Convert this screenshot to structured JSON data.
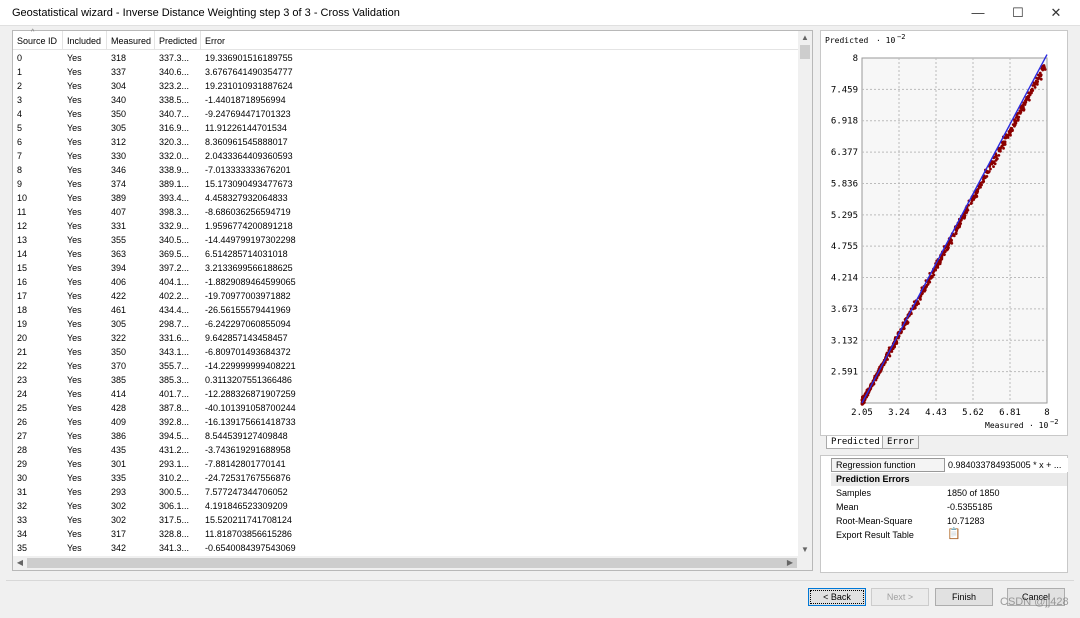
{
  "window": {
    "title": "Geostatistical wizard - Inverse Distance Weighting step 3 of 3 - Cross Validation",
    "minimize_icon": "minimize-icon",
    "maximize_icon": "maximize-icon",
    "close_icon": "close-icon"
  },
  "table": {
    "columns": [
      "Source ID",
      "Included",
      "Measured",
      "Predicted",
      "Error"
    ],
    "rows": [
      [
        "0",
        "Yes",
        "318",
        "337.3...",
        "19.336901516189755"
      ],
      [
        "1",
        "Yes",
        "337",
        "340.6...",
        "3.6767641490354777"
      ],
      [
        "2",
        "Yes",
        "304",
        "323.2...",
        "19.231010931887624"
      ],
      [
        "3",
        "Yes",
        "340",
        "338.5...",
        "-1.44018718956994"
      ],
      [
        "4",
        "Yes",
        "350",
        "340.7...",
        "-9.247694471701323"
      ],
      [
        "5",
        "Yes",
        "305",
        "316.9...",
        "11.91226144701534"
      ],
      [
        "6",
        "Yes",
        "312",
        "320.3...",
        "8.360961545888017"
      ],
      [
        "7",
        "Yes",
        "330",
        "332.0...",
        "2.0433364409360593"
      ],
      [
        "8",
        "Yes",
        "346",
        "338.9...",
        "-7.013333333676201"
      ],
      [
        "9",
        "Yes",
        "374",
        "389.1...",
        "15.173090493477673"
      ],
      [
        "10",
        "Yes",
        "389",
        "393.4...",
        "4.458327932064833"
      ],
      [
        "11",
        "Yes",
        "407",
        "398.3...",
        "-8.686036256594719"
      ],
      [
        "12",
        "Yes",
        "331",
        "332.9...",
        "1.9596774200891218"
      ],
      [
        "13",
        "Yes",
        "355",
        "340.5...",
        "-14.449799197302298"
      ],
      [
        "14",
        "Yes",
        "363",
        "369.5...",
        "6.514285714031018"
      ],
      [
        "15",
        "Yes",
        "394",
        "397.2...",
        "3.2133699566188625"
      ],
      [
        "16",
        "Yes",
        "406",
        "404.1...",
        "-1.8829089464599065"
      ],
      [
        "17",
        "Yes",
        "422",
        "402.2...",
        "-19.70977003971882"
      ],
      [
        "18",
        "Yes",
        "461",
        "434.4...",
        "-26.56155579441969"
      ],
      [
        "19",
        "Yes",
        "305",
        "298.7...",
        "-6.242297060855094"
      ],
      [
        "20",
        "Yes",
        "322",
        "331.6...",
        "9.642857143458457"
      ],
      [
        "21",
        "Yes",
        "350",
        "343.1...",
        "-6.809701493684372"
      ],
      [
        "22",
        "Yes",
        "370",
        "355.7...",
        "-14.229999999408221"
      ],
      [
        "23",
        "Yes",
        "385",
        "385.3...",
        "0.3113207551366486"
      ],
      [
        "24",
        "Yes",
        "414",
        "401.7...",
        "-12.288326871907259"
      ],
      [
        "25",
        "Yes",
        "428",
        "387.8...",
        "-40.101391058700244"
      ],
      [
        "26",
        "Yes",
        "409",
        "392.8...",
        "-16.139175661418733"
      ],
      [
        "27",
        "Yes",
        "386",
        "394.5...",
        "8.544539127409848"
      ],
      [
        "28",
        "Yes",
        "435",
        "431.2...",
        "-3.743619291688958"
      ],
      [
        "29",
        "Yes",
        "301",
        "293.1...",
        "-7.88142801770141"
      ],
      [
        "30",
        "Yes",
        "335",
        "310.2...",
        "-24.72531767556876"
      ],
      [
        "31",
        "Yes",
        "293",
        "300.5...",
        "7.577247344706052"
      ],
      [
        "32",
        "Yes",
        "302",
        "306.1...",
        "4.191846523309209"
      ],
      [
        "33",
        "Yes",
        "302",
        "317.5...",
        "15.520211741708124"
      ],
      [
        "34",
        "Yes",
        "317",
        "328.8...",
        "11.818703856615286"
      ],
      [
        "35",
        "Yes",
        "342",
        "341.3...",
        "-0.6540084397543069"
      ]
    ]
  },
  "chart_data": {
    "type": "scatter",
    "ylabel": "Predicted",
    "yunit": "· 10",
    "yexp": "−2",
    "xlabel": "Measured",
    "xunit": "· 10",
    "xexp": "−2",
    "xlim": [
      2.05,
      8
    ],
    "ylim": [
      2.05,
      8
    ],
    "xticks": [
      "2.05",
      "3.24",
      "4.43",
      "5.62",
      "6.81",
      "8"
    ],
    "yticks": [
      "2.591",
      "3.132",
      "3.673",
      "4.214",
      "4.755",
      "5.295",
      "5.836",
      "6.377",
      "6.918",
      "7.459",
      "8"
    ],
    "grid": true,
    "point_color": "#8b0000",
    "line_color": "#2a2ae0",
    "regression_slope": 0.984033784934005,
    "n_points": 1850
  },
  "tabs": [
    "Predicted",
    "Error"
  ],
  "props": {
    "regression_label": "Regression function",
    "regression_value": "0.984033784935005 * x + ...",
    "section": "Prediction Errors",
    "samples_label": "Samples",
    "samples_value": "1850 of 1850",
    "mean_label": "Mean",
    "mean_value": "-0.5355185",
    "rms_label": "Root-Mean-Square",
    "rms_value": "10.71283",
    "export_label": "Export Result Table",
    "export_icon": "export-table-icon"
  },
  "buttons": {
    "back": "< Back",
    "next": "Next >",
    "finish": "Finish",
    "cancel": "Cancel"
  },
  "watermark": "CSDN @jj428"
}
